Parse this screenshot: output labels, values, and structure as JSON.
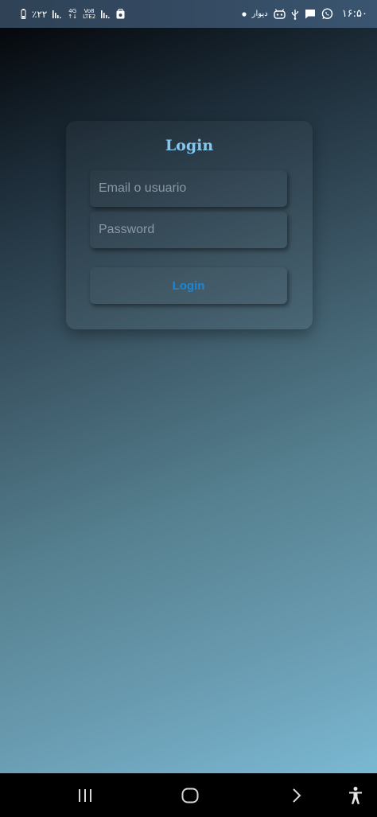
{
  "status_bar": {
    "battery_text": "٪۲۲",
    "net_4g_top": "4G",
    "net_4g_bottom": "↑↓",
    "volte_top": "Vo8",
    "volte_bottom": "LTE2",
    "persian_label": "دیوار",
    "time": "۱۶:۵۰"
  },
  "login": {
    "title": "Login",
    "email_placeholder": "Email o usuario",
    "password_placeholder": "Password",
    "button_label": "Login",
    "title_color": "#86c7ef",
    "button_color": "#1b87d4"
  },
  "nav": {
    "icons": [
      "recent-apps-icon",
      "home-icon",
      "back-icon",
      "accessibility-icon"
    ]
  }
}
